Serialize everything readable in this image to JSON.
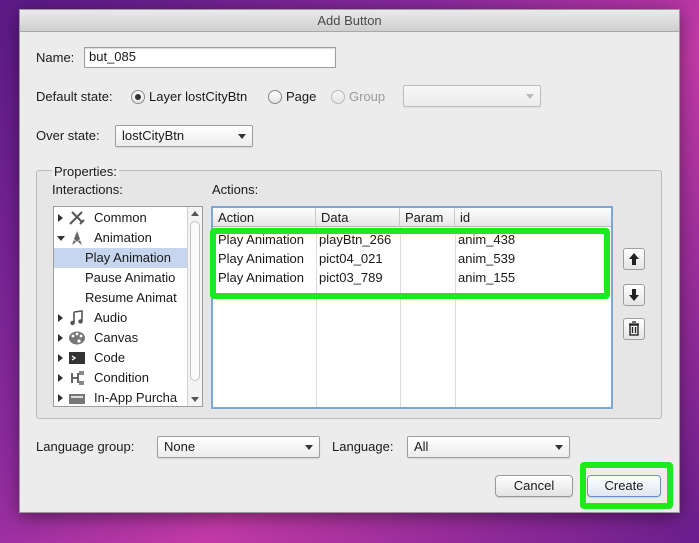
{
  "window": {
    "title": "Add Button"
  },
  "name": {
    "label": "Name:",
    "value": "but_085"
  },
  "default_state": {
    "label": "Default state:",
    "options": [
      {
        "label": "Layer lostCityBtn",
        "selected": true
      },
      {
        "label": "Page",
        "selected": false
      },
      {
        "label": "Group",
        "selected": false,
        "disabled": true
      }
    ],
    "group_select_value": ""
  },
  "over_state": {
    "label": "Over state:",
    "value": "lostCityBtn"
  },
  "properties": {
    "label": "Properties:",
    "interactions_label": "Interactions:",
    "actions_label": "Actions:",
    "tree": [
      {
        "label": "Common",
        "icon": "tools-icon",
        "expanded": false
      },
      {
        "label": "Animation",
        "icon": "rocket-icon",
        "expanded": true
      },
      {
        "label": "Play Animation",
        "child": true,
        "selected": true
      },
      {
        "label": "Pause Animatio",
        "child": true
      },
      {
        "label": "Resume Animat",
        "child": true
      },
      {
        "label": "Audio",
        "icon": "music-note-icon",
        "expanded": false
      },
      {
        "label": "Canvas",
        "icon": "palette-icon",
        "expanded": false
      },
      {
        "label": "Code",
        "icon": "terminal-icon",
        "expanded": false
      },
      {
        "label": "Condition",
        "icon": "condition-icon",
        "expanded": false
      },
      {
        "label": "In-App Purcha",
        "icon": "store-icon",
        "expanded": false
      }
    ],
    "table": {
      "columns": [
        "Action",
        "Data",
        "Param",
        "id"
      ],
      "rows": [
        [
          "Play Animation",
          "playBtn_266",
          "",
          "anim_438"
        ],
        [
          "Play Animation",
          "pict04_021",
          "",
          "anim_539"
        ],
        [
          "Play Animation",
          "pict03_789",
          "",
          "anim_155"
        ]
      ]
    }
  },
  "language_group": {
    "label": "Language group:",
    "value": "None"
  },
  "language": {
    "label": "Language:",
    "value": "All"
  },
  "buttons": {
    "cancel": "Cancel",
    "create": "Create"
  },
  "colors": {
    "highlight": "#1ee81e",
    "selection": "#c7d6ee",
    "focus_ring": "#7aa7d8"
  }
}
